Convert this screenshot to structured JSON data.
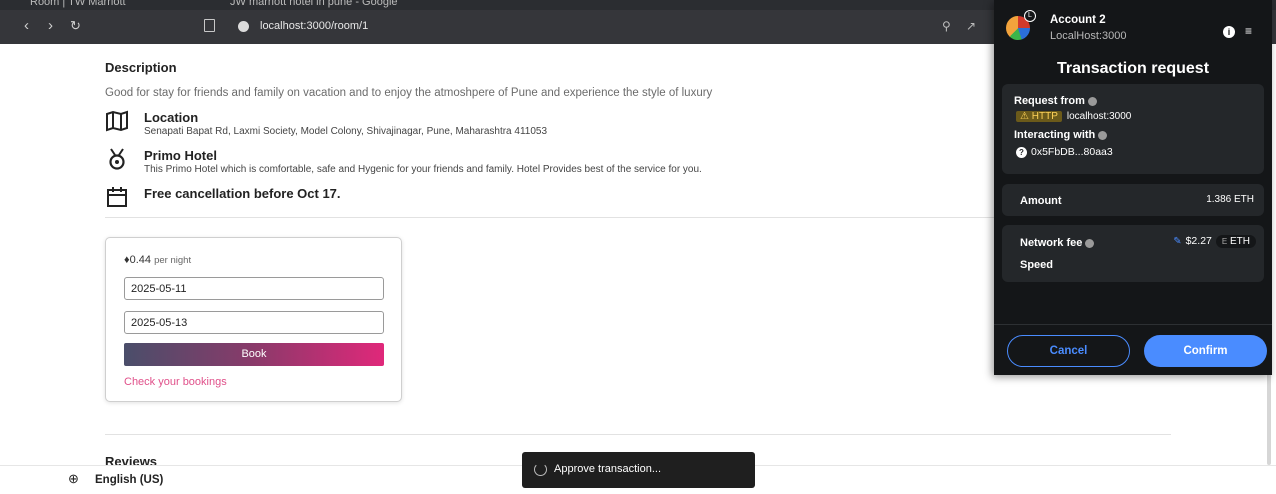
{
  "browser": {
    "tabs": [
      {
        "label": "Room | TW Marriott"
      },
      {
        "label": "JW marriott hotel in pune - Google"
      }
    ],
    "url": "localhost:3000/room/1"
  },
  "room": {
    "description_heading": "Description",
    "description_text": "Good for stay for friends and family on vacation and to enjoy the atmoshpere of Pune and experience the style of luxury",
    "features": [
      {
        "title": "Location",
        "subtitle": "Senapati Bapat Rd, Laxmi Society, Model Colony, Shivajinagar, Pune, Maharashtra 411053",
        "icon": "map-icon"
      },
      {
        "title": "Primo Hotel",
        "subtitle": "This Primo Hotel which is comfortable, safe and Hygenic for your friends and family. Hotel Provides best of the service for you.",
        "icon": "medal-icon"
      },
      {
        "title": "Free cancellation before Oct 17.",
        "subtitle": "",
        "icon": "calendar-icon"
      }
    ],
    "booking": {
      "price": "0.44",
      "per_night": "per night",
      "checkin": "2025-05-11",
      "checkout": "2025-05-13",
      "book_label": "Book",
      "bookings_link": "Check your bookings"
    },
    "reviews_heading": "Reviews"
  },
  "footer": {
    "language": "English (US)"
  },
  "toast": {
    "text": "Approve transaction..."
  },
  "metamask": {
    "account_name": "Account 2",
    "account_badge": "L",
    "account_host": "LocalHost:3000",
    "title": "Transaction request",
    "request_from_label": "Request from",
    "http_chip": "HTTP",
    "request_host": "localhost:3000",
    "interacting_label": "Interacting with",
    "contract_address": "0x5FbDB...80aa3",
    "amount_label": "Amount",
    "amount_value": "1.386 ETH",
    "network_fee_label": "Network fee",
    "network_fee_value": "$2.27",
    "fee_currency": "ETH",
    "fee_currency_icon_letter": "E",
    "speed_label": "Speed",
    "cancel_label": "Cancel",
    "confirm_label": "Confirm",
    "accent_color": "#4a8cff"
  }
}
